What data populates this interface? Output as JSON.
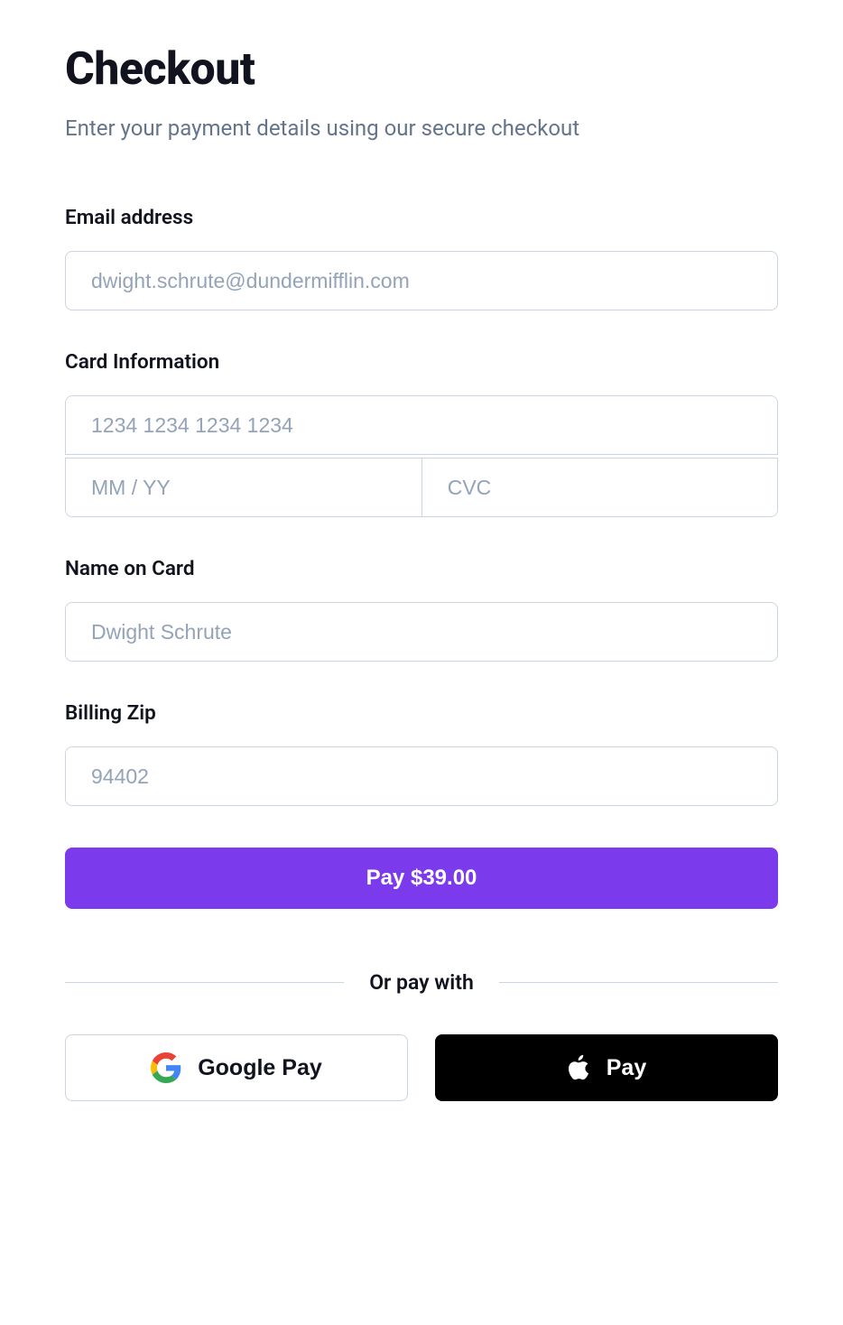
{
  "header": {
    "title": "Checkout",
    "subtitle": "Enter your payment details using our secure checkout"
  },
  "form": {
    "email": {
      "label": "Email address",
      "placeholder": "dwight.schrute@dundermifflin.com"
    },
    "card": {
      "label": "Card Information",
      "number_placeholder": "1234 1234 1234 1234",
      "expiry_placeholder": "MM / YY",
      "cvc_placeholder": "CVC"
    },
    "name": {
      "label": "Name on Card",
      "placeholder": "Dwight Schrute"
    },
    "zip": {
      "label": "Billing Zip",
      "placeholder": "94402"
    },
    "submit_label": "Pay $39.00"
  },
  "alt": {
    "divider_text": "Or pay with",
    "google_label": "Google Pay",
    "apple_label": "Pay"
  }
}
